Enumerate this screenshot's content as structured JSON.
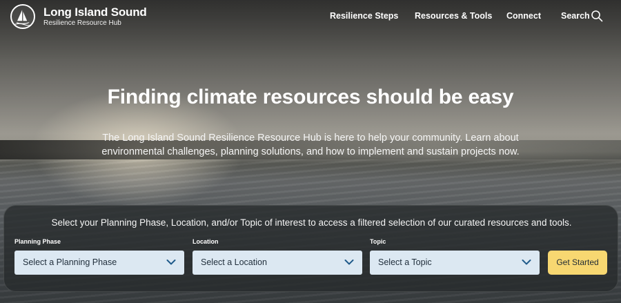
{
  "brand": {
    "title": "Long Island Sound",
    "subtitle": "Resilience Resource Hub",
    "logo_icon": "sailboat-logo-icon"
  },
  "nav": {
    "items": [
      {
        "label": "Resilience Steps"
      },
      {
        "label": "Resources & Tools"
      },
      {
        "label": "Connect"
      },
      {
        "label": "Search"
      }
    ],
    "search_icon": "search-icon"
  },
  "hero": {
    "heading": "Finding climate resources should be easy",
    "lead": "The Long Island Sound Resilience Resource Hub is here to help your community. Learn about environmental challenges, planning solutions, and how to implement and sustain projects now."
  },
  "filter": {
    "intro": "Select your Planning Phase, Location, and/or Topic of interest to access a filtered selection of our curated resources and tools.",
    "fields": [
      {
        "label": "Planning Phase",
        "value": "Select a Planning Phase"
      },
      {
        "label": "Location",
        "value": "Select a Location"
      },
      {
        "label": "Topic",
        "value": "Select a Topic"
      }
    ],
    "submit_label": "Get Started",
    "chevron_icon": "chevron-down-icon"
  },
  "colors": {
    "select_bg": "#dce8f2",
    "button_bg": "#f7d771",
    "chevron": "#1f5a8a",
    "panel_bg": "#262a2c"
  }
}
